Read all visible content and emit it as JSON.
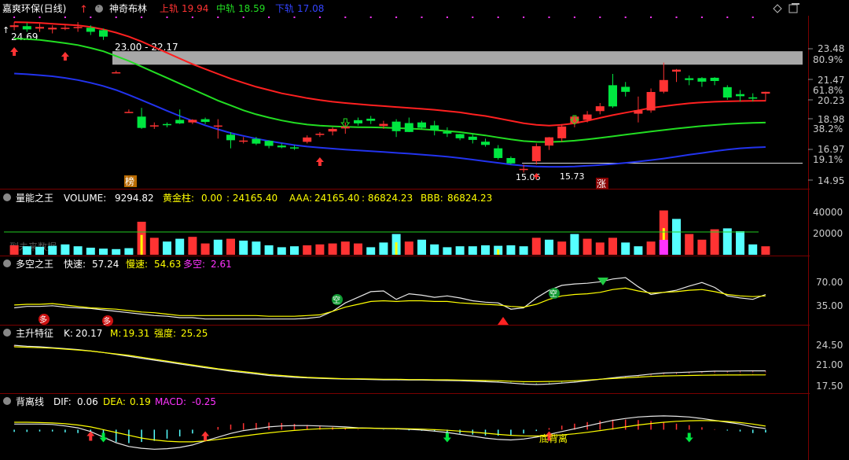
{
  "colors": {
    "up": "#ff3333",
    "down": "#00e640",
    "upper": "#ff2020",
    "mid": "#22dd22",
    "lower": "#2233ee",
    "white": "#e8e8e8",
    "yellow": "#ffff00",
    "cyan": "#55ffff",
    "magenta": "#ff33ff",
    "grid": "#7a0000",
    "axis": "#b0b0b0"
  },
  "header": {
    "stock": "嘉爽环保(日线)",
    "indicator": "神奇布林",
    "upper_label": "上轨",
    "upper_value": "19.94",
    "mid_label": "中轨",
    "mid_value": "18.59",
    "lower_label": "下轨",
    "lower_value": "17.08"
  },
  "window_icons": {
    "diamond": "diamond-icon",
    "restore": "restore-icon"
  },
  "main_panel": {
    "y_ticks": [
      "23.48",
      "21.47",
      "20.23",
      "18.98",
      "16.97",
      "14.95"
    ],
    "pct_ticks": [
      "80.9%",
      "61.8%",
      "38.2%",
      "19.1%"
    ],
    "high_label": "24.69",
    "gap_label": "23.00 - 22.17",
    "low_label": "15.06",
    "low_label2": "15.73",
    "badge_left": "榜",
    "badge_right": "涨",
    "no_data_note": "到未来数据"
  },
  "volume_panel": {
    "name": "量能之王",
    "vol_label": "VOLUME:",
    "vol_value": "9294.82",
    "gold_label": "黄金柱:",
    "gold_value": "0.00",
    "extra_value": ": 24165.40",
    "aaa_label": "AAA:",
    "aaa_value": "24165.40",
    "bbb_prefix": ": 86824.23",
    "bbb_label": "BBB:",
    "bbb_value": "86824.23",
    "y_ticks": [
      "40000",
      "20000"
    ]
  },
  "ls_panel": {
    "name": "多空之王",
    "fast_label": "快速:",
    "fast_value": "57.24",
    "slow_label": "慢速:",
    "slow_value": "54.63",
    "ls_label": "多空:",
    "ls_value": "2.61",
    "y_ticks": [
      "70.00",
      "35.00"
    ],
    "sig_duo": "多",
    "sig_kong": "空"
  },
  "main_rise_panel": {
    "name": "主升特征",
    "k_label": "K:",
    "k_value": "20.17",
    "m_label": "M:",
    "m_value": "19.31",
    "str_label": "强度:",
    "str_value": "25.25",
    "y_ticks": [
      "24.50",
      "21.00",
      "17.50"
    ]
  },
  "divergence_panel": {
    "name": "背离线",
    "dif_label": "DIF:",
    "dif_value": "0.06",
    "dea_label": "DEA:",
    "dea_value": "0.19",
    "macd_label": "MACD:",
    "macd_value": "-0.25",
    "signal_text": "底背离"
  },
  "chart_data": [
    {
      "type": "candlestick",
      "name": "嘉爽环保(日线)",
      "ylim": [
        14.6,
        25.0
      ],
      "candles": [
        [
          24.5,
          24.6,
          24.8,
          24.3
        ],
        [
          24.55,
          24.35,
          24.75,
          24.2
        ],
        [
          24.4,
          24.5,
          24.7,
          24.2
        ],
        [
          24.35,
          24.45,
          24.6,
          24.1
        ],
        [
          24.4,
          24.45,
          24.6,
          24.3
        ],
        [
          24.5,
          24.5,
          24.8,
          24.2
        ],
        [
          24.45,
          24.2,
          24.6,
          24.0
        ],
        [
          24.3,
          23.9,
          24.4,
          23.7
        ],
        [
          21.7,
          21.7,
          21.8,
          21.7
        ],
        [
          19.25,
          19.25,
          19.4,
          19.2
        ],
        [
          18.96,
          18.26,
          19.5,
          18.2
        ],
        [
          18.35,
          18.42,
          18.6,
          18.2
        ],
        [
          18.5,
          18.45,
          18.6,
          18.3
        ],
        [
          18.76,
          18.54,
          19.4,
          18.5
        ],
        [
          18.6,
          18.76,
          18.8,
          18.5
        ],
        [
          18.8,
          18.63,
          18.9,
          18.5
        ],
        [
          18.4,
          18.41,
          18.8,
          17.6
        ],
        [
          17.84,
          17.5,
          18.0,
          17.0
        ],
        [
          17.48,
          17.48,
          17.7,
          17.3
        ],
        [
          17.58,
          17.29,
          17.7,
          17.2
        ],
        [
          17.46,
          17.15,
          17.5,
          17.0
        ],
        [
          17.17,
          17.06,
          17.3,
          17.0
        ],
        [
          17.06,
          17.04,
          17.2,
          16.9
        ],
        [
          17.4,
          17.67,
          17.8,
          17.3
        ],
        [
          17.87,
          17.9,
          18.0,
          17.7
        ],
        [
          18.04,
          18.2,
          18.3,
          17.8
        ],
        [
          18.23,
          18.35,
          18.6,
          17.9
        ],
        [
          18.74,
          18.54,
          18.9,
          18.4
        ],
        [
          18.83,
          18.7,
          19.0,
          18.5
        ],
        [
          18.38,
          18.51,
          18.7,
          18.2
        ],
        [
          18.65,
          18.06,
          18.8,
          17.7
        ],
        [
          18.56,
          18.01,
          18.9,
          18.0
        ],
        [
          18.6,
          18.27,
          18.7,
          18.2
        ],
        [
          18.42,
          18.12,
          18.7,
          17.8
        ],
        [
          18.03,
          17.91,
          18.3,
          17.7
        ],
        [
          17.88,
          17.62,
          17.9,
          17.5
        ],
        [
          17.72,
          17.52,
          17.9,
          17.3
        ],
        [
          17.41,
          17.21,
          17.6,
          17.1
        ],
        [
          17.0,
          16.4,
          17.2,
          16.3
        ],
        [
          16.4,
          16.07,
          16.5,
          16.0
        ],
        [
          15.73,
          15.73,
          16.0,
          15.5
        ],
        [
          16.2,
          17.13,
          17.3,
          16.0
        ],
        [
          17.17,
          17.68,
          17.7,
          16.9
        ],
        [
          17.62,
          18.35,
          18.5,
          17.4
        ],
        [
          18.54,
          18.96,
          19.0,
          18.3
        ],
        [
          18.76,
          19.09,
          19.3,
          18.6
        ],
        [
          19.3,
          19.6,
          19.8,
          19.1
        ],
        [
          20.9,
          19.59,
          21.6,
          19.5
        ],
        [
          20.8,
          20.49,
          21.1,
          20.2
        ],
        [
          19.14,
          19.35,
          20.2,
          18.6
        ],
        [
          19.34,
          20.48,
          20.7,
          19.2
        ],
        [
          20.5,
          21.22,
          22.3,
          20.4
        ],
        [
          21.74,
          21.86,
          21.9,
          21.1
        ],
        [
          21.33,
          21.22,
          21.5,
          20.9
        ],
        [
          21.34,
          21.12,
          21.4,
          20.8
        ],
        [
          21.36,
          21.16,
          21.4,
          20.9
        ],
        [
          20.78,
          20.14,
          20.9,
          20.0
        ],
        [
          20.35,
          20.22,
          20.6,
          19.9
        ],
        [
          20.15,
          20.07,
          20.4,
          19.9
        ],
        [
          20.38,
          20.49,
          20.5,
          19.9
        ]
      ],
      "upper": [
        24.8,
        24.78,
        24.75,
        24.7,
        24.65,
        24.6,
        24.5,
        24.35,
        24.15,
        23.9,
        23.6,
        23.25,
        22.9,
        22.55,
        22.2,
        21.9,
        21.6,
        21.3,
        21.05,
        20.8,
        20.6,
        20.4,
        20.25,
        20.1,
        19.98,
        19.88,
        19.8,
        19.73,
        19.67,
        19.61,
        19.55,
        19.5,
        19.44,
        19.38,
        19.3,
        19.22,
        19.1,
        19.0,
        18.85,
        18.7,
        18.55,
        18.45,
        18.4,
        18.45,
        18.55,
        18.7,
        18.88,
        19.05,
        19.2,
        19.35,
        19.5,
        19.6,
        19.7,
        19.78,
        19.84,
        19.88,
        19.9,
        19.92,
        19.93,
        19.94
      ],
      "mid": [
        23.78,
        23.75,
        23.7,
        23.6,
        23.5,
        23.38,
        23.2,
        23.0,
        22.7,
        22.4,
        22.05,
        21.7,
        21.35,
        21.0,
        20.65,
        20.3,
        19.95,
        19.65,
        19.35,
        19.1,
        18.9,
        18.72,
        18.58,
        18.47,
        18.4,
        18.36,
        18.33,
        18.31,
        18.3,
        18.28,
        18.25,
        18.22,
        18.18,
        18.13,
        18.07,
        18.0,
        17.9,
        17.8,
        17.67,
        17.55,
        17.45,
        17.4,
        17.39,
        17.42,
        17.47,
        17.55,
        17.64,
        17.74,
        17.84,
        17.94,
        18.04,
        18.13,
        18.22,
        18.3,
        18.38,
        18.44,
        18.5,
        18.54,
        18.57,
        18.59
      ],
      "lower": [
        21.62,
        21.58,
        21.52,
        21.45,
        21.35,
        21.22,
        21.05,
        20.85,
        20.6,
        20.3,
        19.98,
        19.65,
        19.32,
        19.0,
        18.7,
        18.42,
        18.17,
        17.95,
        17.77,
        17.6,
        17.45,
        17.32,
        17.2,
        17.11,
        17.04,
        16.98,
        16.92,
        16.87,
        16.82,
        16.77,
        16.72,
        16.67,
        16.61,
        16.55,
        16.48,
        16.4,
        16.3,
        16.2,
        16.1,
        16.0,
        15.92,
        15.88,
        15.86,
        15.86,
        15.88,
        15.92,
        15.97,
        16.03,
        16.1,
        16.18,
        16.27,
        16.37,
        16.48,
        16.6,
        16.71,
        16.82,
        16.92,
        17.0,
        17.05,
        17.08
      ],
      "reference_level": 16.08,
      "gap": [
        22.17,
        23.0
      ]
    },
    {
      "type": "bar",
      "name": "量能之王",
      "ylim": [
        0,
        55000
      ],
      "values": [
        10000,
        9000,
        8500,
        9500,
        11000,
        9000,
        7500,
        6500,
        6000,
        7000,
        35000,
        18000,
        14000,
        17000,
        19000,
        12000,
        16000,
        17000,
        15000,
        14000,
        10000,
        8000,
        9000,
        10000,
        11000,
        12000,
        14000,
        12000,
        8000,
        13000,
        22000,
        14000,
        16000,
        11000,
        8000,
        9000,
        9000,
        10000,
        9500,
        10000,
        9000,
        18000,
        16000,
        14000,
        22000,
        17000,
        13000,
        18000,
        13000,
        9000,
        14000,
        47000,
        38000,
        22000,
        16000,
        27000,
        28000,
        25000,
        11000,
        9000
      ],
      "color": [
        "up",
        "down",
        "down",
        "down",
        "down",
        "down",
        "down",
        "down",
        "down",
        "down",
        "up",
        "up",
        "down",
        "down",
        "up",
        "up",
        "down",
        "up",
        "down",
        "down",
        "down",
        "down",
        "down",
        "up",
        "up",
        "up",
        "up",
        "up",
        "down",
        "down",
        "down",
        "up",
        "down",
        "down",
        "down",
        "down",
        "down",
        "down",
        "down",
        "down",
        "down",
        "up",
        "down",
        "up",
        "down",
        "up",
        "up",
        "up",
        "down",
        "down",
        "up",
        "up",
        "down",
        "up",
        "up",
        "up",
        "down",
        "down",
        "down",
        "up"
      ],
      "line": 24165.4
    },
    {
      "type": "line",
      "name": "多空之王",
      "ylim": [
        15,
        90
      ],
      "fast": [
        38,
        40,
        40,
        41,
        39,
        38,
        37,
        35,
        33,
        31,
        29,
        27,
        26,
        24,
        24,
        22,
        22,
        22,
        22,
        22,
        22,
        22,
        22,
        23,
        25,
        33,
        45,
        53,
        61,
        62,
        50,
        58,
        56,
        53,
        55,
        52,
        48,
        46,
        45,
        36,
        38,
        52,
        63,
        70,
        72,
        73,
        75,
        79,
        81,
        68,
        57,
        60,
        63,
        69,
        74,
        67,
        55,
        52,
        50,
        57
      ],
      "slow": [
        42,
        43,
        43,
        44,
        42,
        40,
        38,
        37,
        36,
        34,
        32,
        31,
        29,
        27,
        27,
        27,
        27,
        27,
        27,
        27,
        26,
        26,
        26,
        27,
        28,
        33,
        39,
        43,
        47,
        48,
        47,
        48,
        48,
        47,
        47,
        45,
        44,
        43,
        42,
        40,
        39,
        43,
        50,
        55,
        57,
        58,
        60,
        64,
        66,
        62,
        59,
        60,
        61,
        63,
        64,
        61,
        57,
        55,
        54,
        55
      ]
    },
    {
      "type": "line",
      "name": "主升特征",
      "ylim": [
        15.5,
        27
      ],
      "k": [
        25.5,
        25.3,
        25.2,
        25.0,
        24.8,
        24.6,
        24.3,
        24.0,
        23.6,
        23.2,
        22.8,
        22.4,
        22.0,
        21.6,
        21.2,
        20.8,
        20.5,
        20.1,
        19.8,
        19.5,
        19.2,
        19.0,
        18.8,
        18.7,
        18.6,
        18.5,
        18.45,
        18.4,
        18.35,
        18.3,
        18.3,
        18.25,
        18.25,
        18.2,
        18.15,
        18.1,
        18.0,
        17.9,
        17.8,
        17.6,
        17.4,
        17.3,
        17.4,
        17.6,
        17.8,
        18.1,
        18.4,
        18.7,
        19.0,
        19.2,
        19.5,
        19.7,
        19.8,
        19.9,
        20.0,
        20.1,
        20.1,
        20.15,
        20.17,
        20.17
      ],
      "m": [
        25.2,
        25.1,
        25.0,
        24.9,
        24.7,
        24.5,
        24.3,
        24.0,
        23.7,
        23.4,
        23.0,
        22.6,
        22.2,
        21.8,
        21.4,
        21.0,
        20.6,
        20.3,
        20.0,
        19.7,
        19.4,
        19.2,
        19.0,
        18.8,
        18.7,
        18.6,
        18.5,
        18.5,
        18.45,
        18.4,
        18.4,
        18.35,
        18.35,
        18.3,
        18.3,
        18.25,
        18.2,
        18.15,
        18.1,
        18.0,
        17.9,
        17.9,
        17.95,
        18.0,
        18.1,
        18.25,
        18.4,
        18.55,
        18.7,
        18.85,
        19.0,
        19.1,
        19.15,
        19.2,
        19.25,
        19.28,
        19.3,
        19.3,
        19.31,
        19.31
      ]
    },
    {
      "type": "line",
      "name": "背离线",
      "ylim": [
        -1.5,
        1.2
      ],
      "dif": [
        0.3,
        0.3,
        0.3,
        0.28,
        0.2,
        0.1,
        -0.1,
        -0.4,
        -0.7,
        -0.9,
        -1.0,
        -1.05,
        -1.02,
        -0.95,
        -0.82,
        -0.6,
        -0.4,
        -0.2,
        -0.05,
        0.05,
        0.15,
        0.2,
        0.22,
        0.22,
        0.2,
        0.18,
        0.15,
        0.1,
        0.08,
        0.06,
        0.05,
        0.02,
        -0.02,
        -0.08,
        -0.15,
        -0.25,
        -0.35,
        -0.45,
        -0.52,
        -0.55,
        -0.5,
        -0.4,
        -0.25,
        -0.1,
        0.05,
        0.2,
        0.35,
        0.5,
        0.6,
        0.68,
        0.72,
        0.74,
        0.72,
        0.68,
        0.6,
        0.5,
        0.4,
        0.3,
        0.15,
        0.06
      ],
      "dea": [
        0.4,
        0.4,
        0.38,
        0.36,
        0.32,
        0.25,
        0.15,
        0.0,
        -0.15,
        -0.3,
        -0.45,
        -0.55,
        -0.62,
        -0.65,
        -0.65,
        -0.6,
        -0.52,
        -0.43,
        -0.34,
        -0.25,
        -0.17,
        -0.1,
        -0.04,
        0.01,
        0.05,
        0.07,
        0.08,
        0.08,
        0.08,
        0.07,
        0.06,
        0.05,
        0.03,
        0.0,
        -0.03,
        -0.08,
        -0.13,
        -0.19,
        -0.25,
        -0.3,
        -0.33,
        -0.34,
        -0.32,
        -0.28,
        -0.22,
        -0.14,
        -0.05,
        0.05,
        0.15,
        0.25,
        0.33,
        0.4,
        0.45,
        0.48,
        0.49,
        0.48,
        0.44,
        0.38,
        0.3,
        0.19
      ],
      "macd": [
        -0.2,
        -0.2,
        -0.16,
        -0.16,
        -0.24,
        -0.3,
        -0.5,
        -0.8,
        -1.1,
        -1.2,
        -1.1,
        -1.0,
        -0.8,
        -0.6,
        -0.34,
        0.0,
        0.24,
        0.46,
        0.58,
        0.6,
        0.64,
        0.6,
        0.52,
        0.42,
        0.3,
        0.22,
        0.14,
        0.04,
        0.0,
        -0.02,
        -0.02,
        -0.06,
        -0.1,
        -0.16,
        -0.24,
        -0.34,
        -0.44,
        -0.52,
        -0.54,
        -0.5,
        -0.34,
        -0.12,
        0.14,
        0.36,
        0.54,
        0.68,
        0.8,
        0.9,
        0.9,
        0.86,
        0.78,
        0.68,
        0.54,
        0.4,
        0.22,
        0.04,
        -0.08,
        -0.16,
        -0.3,
        -0.25
      ]
    }
  ]
}
